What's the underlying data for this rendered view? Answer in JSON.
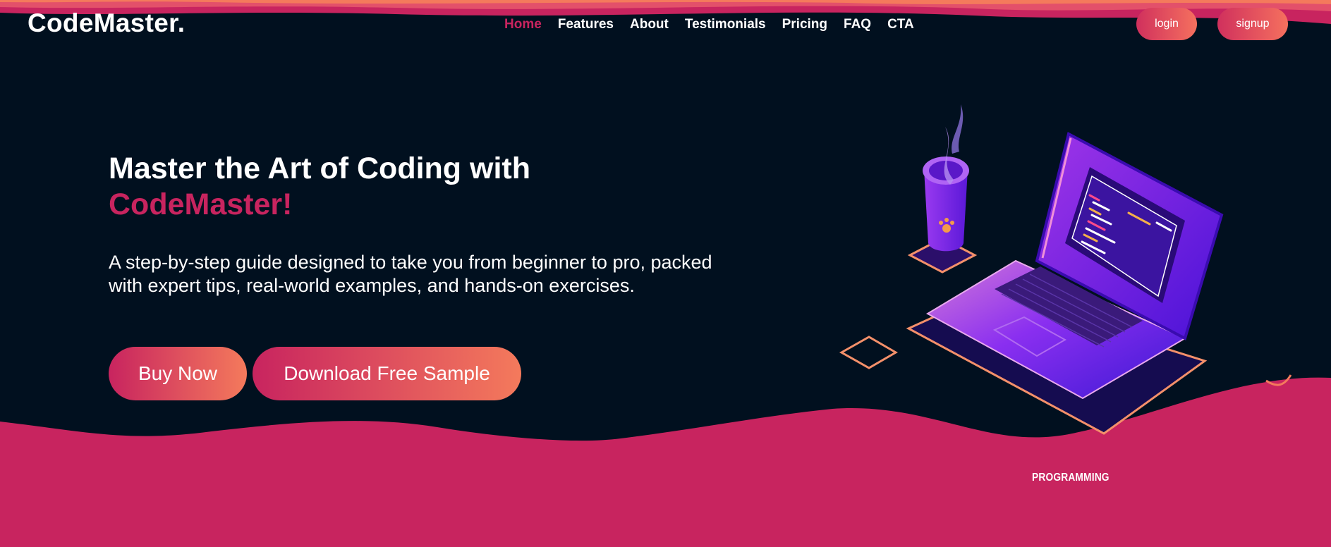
{
  "brand": {
    "name": "CodeMaster."
  },
  "nav": {
    "items": [
      {
        "label": "Home",
        "active": true
      },
      {
        "label": "Features"
      },
      {
        "label": "About"
      },
      {
        "label": "Testimonials"
      },
      {
        "label": "Pricing"
      },
      {
        "label": "FAQ"
      },
      {
        "label": "CTA"
      }
    ]
  },
  "auth": {
    "login_label": "login",
    "signup_label": "signup"
  },
  "hero": {
    "title_line1": "Master the Art of Coding with",
    "title_accent": "CodeMaster!",
    "description": "A step-by-step guide designed to take you from beginner to pro, packed with expert tips, real-world examples, and hands-on exercises.",
    "buy_label": "Buy Now",
    "sample_label": "Download Free Sample"
  },
  "illustration": {
    "tag": "PROGRAMMING"
  },
  "colors": {
    "background": "#01101f",
    "accent": "#c8245f",
    "gradient_start": "#c8245f",
    "gradient_end": "#f47a5c",
    "laptop_purple": "#6a11e8"
  },
  "icons": [
    "laptop-icon",
    "coffee-cup-icon"
  ]
}
